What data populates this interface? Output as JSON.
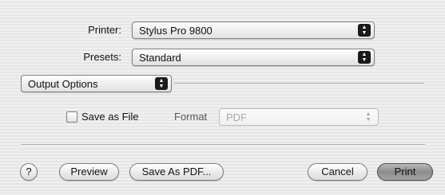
{
  "printer": {
    "label": "Printer:",
    "value": "Stylus Pro 9800"
  },
  "presets": {
    "label": "Presets:",
    "value": "Standard"
  },
  "pane_selector": {
    "value": "Output Options"
  },
  "output": {
    "save_as_file_label": "Save as File",
    "save_as_file_checked": false,
    "format_label": "Format",
    "format_value": "PDF"
  },
  "buttons": {
    "help": "?",
    "preview": "Preview",
    "save_as_pdf": "Save As PDF...",
    "cancel": "Cancel",
    "print": "Print"
  }
}
